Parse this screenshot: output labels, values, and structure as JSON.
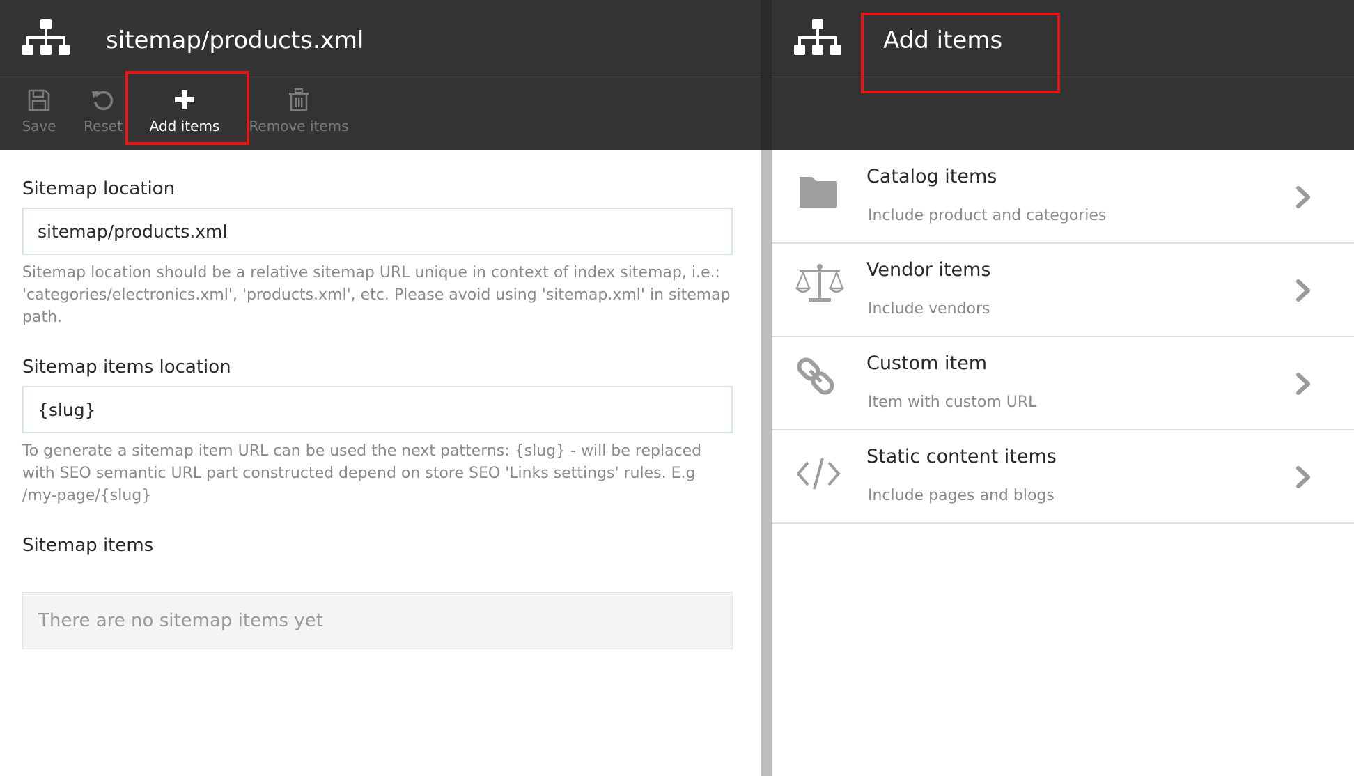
{
  "left_blade": {
    "title": "sitemap/products.xml",
    "toolbar": [
      {
        "label": "Save",
        "icon": "save-icon",
        "state": "disabled"
      },
      {
        "label": "Reset",
        "icon": "undo-icon",
        "state": "disabled"
      },
      {
        "label": "Add items",
        "icon": "plus-icon",
        "state": "active"
      },
      {
        "label": "Remove items",
        "icon": "trash-icon",
        "state": "disabled"
      }
    ],
    "location": {
      "label": "Sitemap location",
      "value": "sitemap/products.xml",
      "hint": "Sitemap location should be a relative sitemap URL unique in context of index sitemap, i.e.: 'categories/electronics.xml', 'products.xml', etc. Please avoid using 'sitemap.xml' in sitemap path."
    },
    "items_location": {
      "label": "Sitemap items location",
      "value": "{slug}",
      "hint": "To generate a sitemap item URL can be used the next patterns: {slug} - will be replaced with SEO semantic URL part constructed depend on store SEO 'Links settings' rules. E.g /my-page/{slug}"
    },
    "items": {
      "label": "Sitemap items",
      "empty_text": "There are no sitemap items yet"
    }
  },
  "right_blade": {
    "title": "Add items",
    "options": [
      {
        "title": "Catalog items",
        "desc": "Include product and categories",
        "icon": "folder-icon"
      },
      {
        "title": "Vendor items",
        "desc": "Include vendors",
        "icon": "balance-scale-icon"
      },
      {
        "title": "Custom item",
        "desc": "Item with custom URL",
        "icon": "link-icon"
      },
      {
        "title": "Static content items",
        "desc": "Include pages and blogs",
        "icon": "code-icon"
      }
    ]
  },
  "colors": {
    "header_bg": "#333333",
    "highlight": "#e11919",
    "field_border": "#d5e3ea",
    "hint_text": "#8a8a8a"
  }
}
